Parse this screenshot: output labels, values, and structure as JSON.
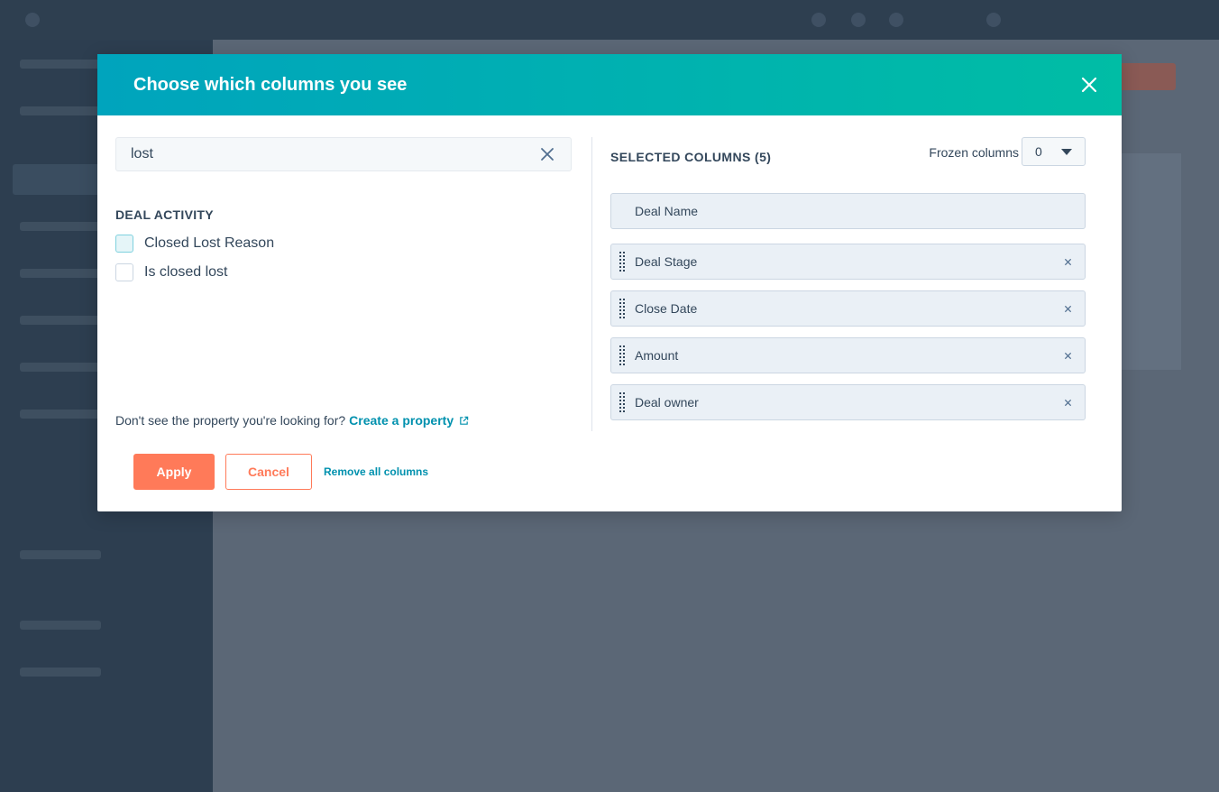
{
  "modal": {
    "title": "Choose which columns you see",
    "search": {
      "value": "lost"
    },
    "group": {
      "title": "DEAL ACTIVITY",
      "options": [
        {
          "label": "Closed Lost Reason",
          "checked": false
        },
        {
          "label": "Is closed lost",
          "checked": false
        }
      ]
    },
    "helper": {
      "text": "Don't see the property you're looking for?",
      "link": "Create a property"
    },
    "selected": {
      "title": "SELECTED COLUMNS (5)",
      "frozen_label": "Frozen columns",
      "frozen_value": "0",
      "columns": [
        {
          "label": "Deal Name",
          "removable": false
        },
        {
          "label": "Deal Stage",
          "removable": true
        },
        {
          "label": "Close Date",
          "removable": true
        },
        {
          "label": "Amount",
          "removable": true
        },
        {
          "label": "Deal owner",
          "removable": true
        }
      ]
    },
    "footer": {
      "apply": "Apply",
      "cancel": "Cancel",
      "remove_all": "Remove all columns"
    }
  },
  "colors": {
    "header_start": "#00a4bd",
    "header_end": "#00bda5",
    "primary": "#ff7a59",
    "link": "#0091ae"
  }
}
